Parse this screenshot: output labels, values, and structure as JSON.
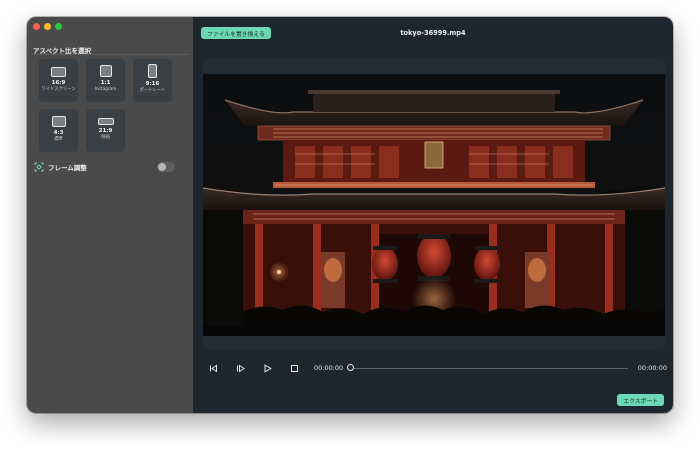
{
  "sidebar": {
    "section_title": "アスペクト比を選択",
    "ratios": [
      {
        "value": "16:9",
        "label": "ワイドスクリーン",
        "icon": "widescreen-ratio-icon"
      },
      {
        "value": "1:1",
        "label": "Instagram",
        "icon": "square-ratio-icon"
      },
      {
        "value": "9:16",
        "label": "ポートレート",
        "icon": "portrait-ratio-icon"
      },
      {
        "value": "4:3",
        "label": "標準",
        "icon": "standard-ratio-icon"
      },
      {
        "value": "21:9",
        "label": "映画",
        "icon": "cinema-ratio-icon"
      }
    ],
    "frame_adjust_label": "フレーム調整",
    "frame_adjust_enabled": false
  },
  "main": {
    "replace_file_label": "ファイルを置き換える",
    "file_name": "tokyo-36999.mp4",
    "playback": {
      "current_time": "00:00:00",
      "total_time": "00:00:00",
      "progress": 0
    },
    "export_label": "エクスポート"
  },
  "colors": {
    "accent": "#6dd8b4",
    "sidebar_bg": "#4a4a4a",
    "main_bg": "#1e272d"
  }
}
